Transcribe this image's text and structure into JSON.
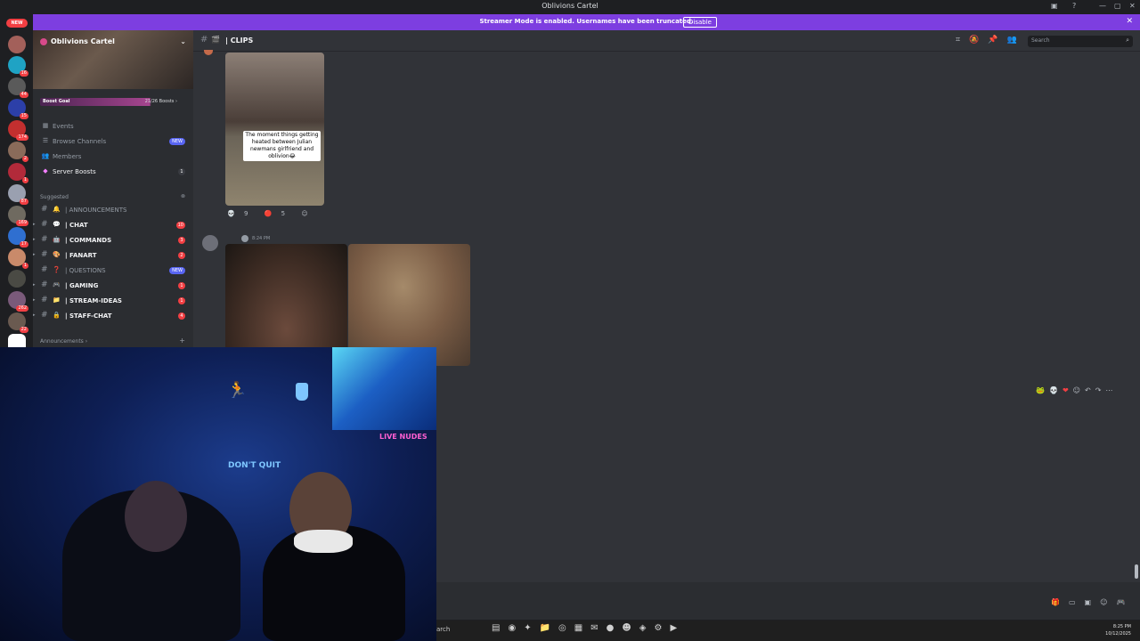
{
  "window": {
    "title": "Oblivions Cartel",
    "controls": [
      "—",
      "▢",
      "✕"
    ]
  },
  "streamer_banner": {
    "text": "Streamer Mode is enabled. Usernames have been truncated.",
    "button_label": "Disable",
    "close": "✕"
  },
  "server_rail": {
    "new_label": "NEW",
    "badges": [
      "16",
      "44",
      "15",
      "174",
      "2",
      "1",
      "87",
      "169",
      "17",
      "1",
      "262",
      "22"
    ]
  },
  "sidebar": {
    "server_name": "Oblivions Cartel",
    "boost_goal_label": "Boost Goal",
    "boost_count": "21/26 Boosts ›",
    "nav": [
      {
        "label": "Events",
        "icon": "calendar-icon"
      },
      {
        "label": "Browse Channels",
        "icon": "channels-icon",
        "badge": "NEW"
      },
      {
        "label": "Members",
        "icon": "members-icon"
      },
      {
        "label": "Server Boosts",
        "icon": "boost-icon",
        "badge": "1"
      }
    ],
    "category_suggested": "Suggested",
    "channels": [
      {
        "emoji": "🔔",
        "name": "| ANNOUNCEMENTS",
        "dim": true
      },
      {
        "emoji": "💬",
        "name": "| CHAT",
        "badge": "10"
      },
      {
        "emoji": "🤖",
        "name": "| COMMANDS",
        "badge": "3"
      },
      {
        "emoji": "🎨",
        "name": "| FANART",
        "badge": "2"
      },
      {
        "emoji": "❓",
        "name": "| QUESTIONS",
        "badge": "NEW",
        "dim": true
      },
      {
        "emoji": "🎮",
        "name": "| GAMING",
        "badge": "1"
      },
      {
        "emoji": "📁",
        "name": "| STREAM-IDEAS",
        "badge": "1"
      },
      {
        "emoji": "🔒",
        "name": "| STAFF-CHAT",
        "badge": "4"
      }
    ],
    "category_announcements": "Announcements ›"
  },
  "channel_header": {
    "channel_name": "| CLIPS",
    "search_placeholder": "Search"
  },
  "messages": {
    "clip_caption": "The moment things getting heated between Julian newmans girlfriend and oblivion😂",
    "reactions": [
      {
        "emoji": "💀",
        "count": "9"
      },
      {
        "emoji": "🔴",
        "count": "5"
      },
      {
        "emoji": "☺",
        "count": ""
      }
    ],
    "second_time": "8:24 PM"
  },
  "hover_toolbar": [
    "🐸",
    "💀",
    "❤",
    "☺",
    "↶",
    "↷",
    "⋯"
  ],
  "taskbar": {
    "search_text": "arch",
    "time": "8:25 PM",
    "date": "10/12/2025"
  },
  "webcam": {
    "neon_left": "DON'T QUIT",
    "neon_right": "LIVE NUDES"
  }
}
